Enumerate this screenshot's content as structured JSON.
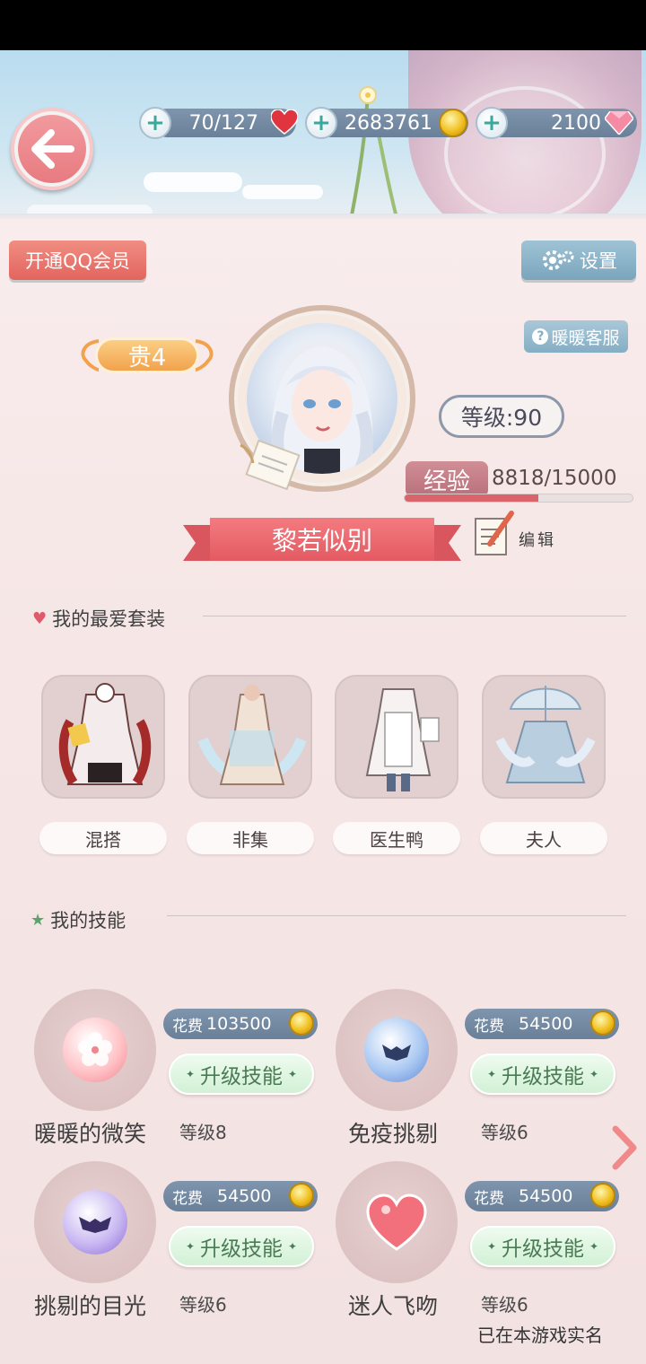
{
  "top_bar": {
    "stamina": "70/127",
    "coins": "2683761",
    "diamonds": "2100"
  },
  "buttons": {
    "qq_vip": "开通QQ会员",
    "settings": "设置",
    "customer_service": "暖暖客服",
    "edit": "编辑"
  },
  "profile": {
    "noble_rank": "贵4",
    "level": "等级:90",
    "exp_label": "经验",
    "exp_value": "8818/15000",
    "exp_progress": 0.588,
    "name": "黎若似别"
  },
  "favorites": {
    "title": "我的最爱套装",
    "outfits": [
      {
        "label": "混搭"
      },
      {
        "label": "非集"
      },
      {
        "label": "医生鸭"
      },
      {
        "label": "夫人"
      }
    ]
  },
  "skills": {
    "title": "我的技能",
    "cost_prefix": "花费",
    "upgrade_label": "升级技能",
    "items": [
      {
        "name": "暖暖的微笑",
        "level": "等级8",
        "cost": "103500"
      },
      {
        "name": "免疫挑剔",
        "level": "等级6",
        "cost": "54500"
      },
      {
        "name": "挑剔的目光",
        "level": "等级6",
        "cost": "54500"
      },
      {
        "name": "迷人飞吻",
        "level": "等级6",
        "cost": "54500"
      }
    ]
  },
  "footer": {
    "realname_notice": "已在本游戏实名"
  },
  "colors": {
    "accent_pink": "#e45a62",
    "resource_bar": "#7f95ad",
    "upgrade_green": "#d2f1d6"
  }
}
